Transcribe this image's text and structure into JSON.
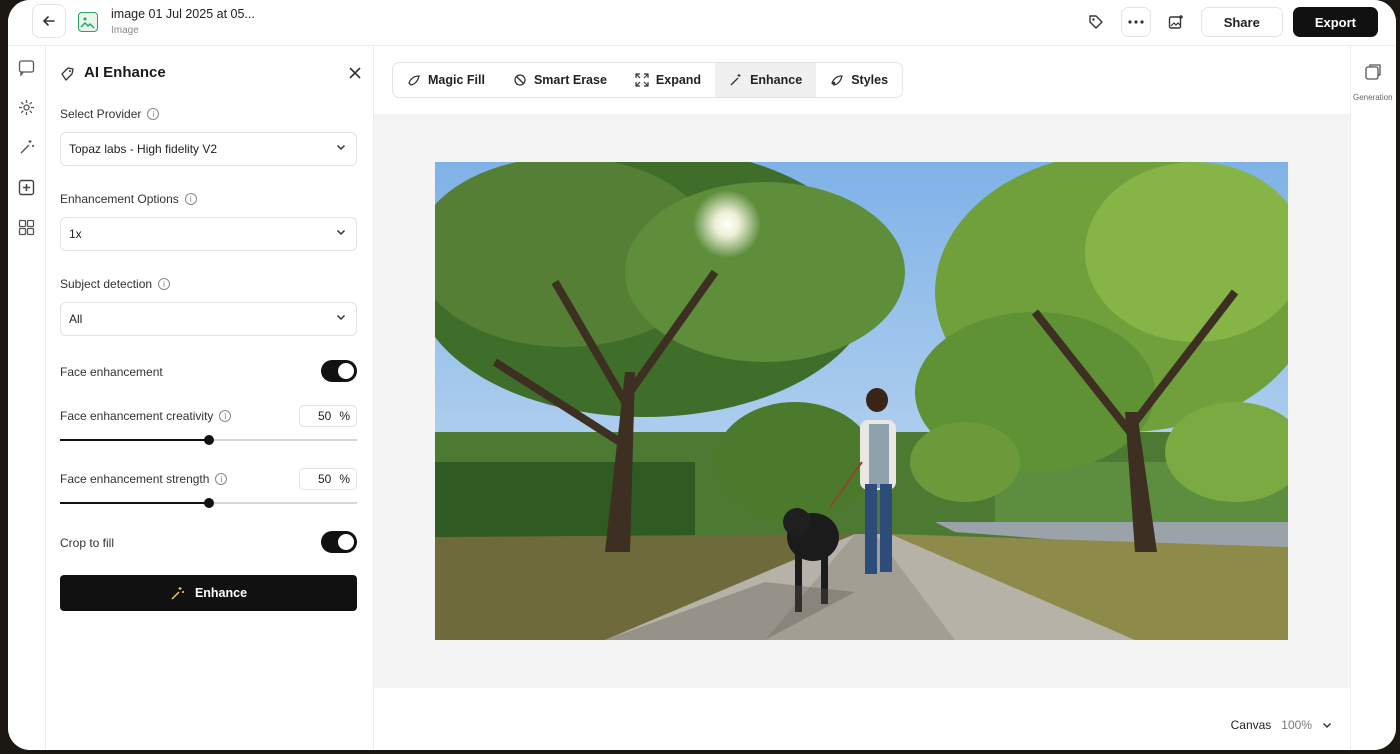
{
  "header": {
    "file_title": "image 01 Jul 2025 at 05...",
    "file_subtitle": "Image",
    "share_label": "Share",
    "export_label": "Export",
    "icons": [
      "back-arrow-icon",
      "image-file-icon",
      "tag-icon",
      "more-icon",
      "image-add-icon"
    ]
  },
  "rail": {
    "icons": [
      "chat-icon",
      "settings-gear-icon",
      "magic-wand-icon",
      "add-media-icon",
      "grid-layout-icon"
    ]
  },
  "panel": {
    "title": "AI Enhance",
    "provider": {
      "label": "Select Provider",
      "value": "Topaz labs - High fidelity V2"
    },
    "enhancement_options": {
      "label": "Enhancement Options",
      "value": "1x"
    },
    "subject_detection": {
      "label": "Subject detection",
      "value": "All"
    },
    "face_enhancement": {
      "label": "Face enhancement",
      "enabled": true
    },
    "face_creativity": {
      "label": "Face enhancement creativity",
      "value": "50",
      "unit": "%",
      "level": 0.5
    },
    "face_strength": {
      "label": "Face enhancement strength",
      "value": "50",
      "unit": "%",
      "level": 0.5
    },
    "crop_to_fill": {
      "label": "Crop to fill",
      "enabled": true
    },
    "enhance_button": "Enhance"
  },
  "toolbar": {
    "tools": [
      {
        "label": "Magic Fill",
        "icon": "magic-fill-icon",
        "active": false
      },
      {
        "label": "Smart Erase",
        "icon": "erase-icon",
        "active": false
      },
      {
        "label": "Expand",
        "icon": "expand-icon",
        "active": false
      },
      {
        "label": "Enhance",
        "icon": "enhance-icon",
        "active": true
      },
      {
        "label": "Styles",
        "icon": "styles-icon",
        "active": false
      }
    ]
  },
  "canvas": {
    "label": "Canvas",
    "zoom": "100%",
    "image_alt": "Woman walking a black dog on a sunny tree-lined sidewalk"
  },
  "right_rail": {
    "label": "Generation",
    "icon": "generation-icon"
  },
  "colors": {
    "accent": "#111111",
    "file_icon": "#2aa25c",
    "canvas_bg": "#f4f4f4"
  }
}
